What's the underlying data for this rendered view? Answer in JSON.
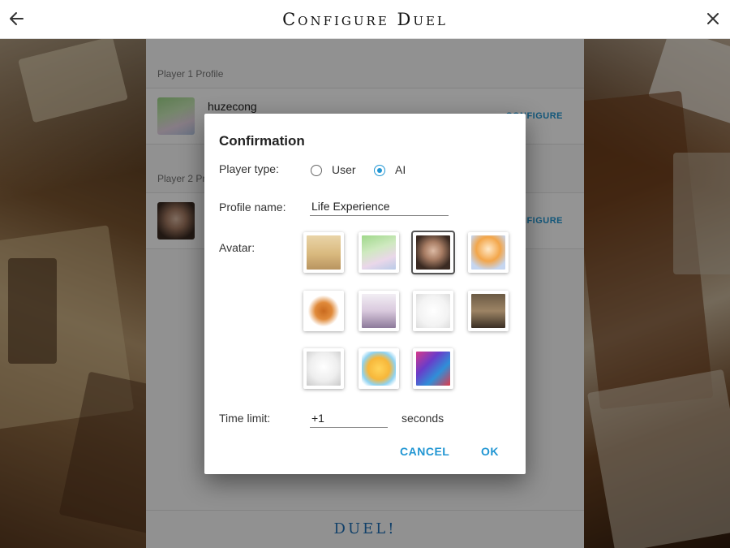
{
  "appbar": {
    "title": "Configure Duel",
    "back_icon": "arrow-left-icon",
    "close_icon": "close-icon"
  },
  "panel": {
    "player1_label": "Player 1 Profile",
    "player1_name": "huzecong",
    "player1_configure": "CONFIGURE",
    "player2_label": "Player 2 Profile",
    "player2_configure": "CONFIGURE",
    "duel_label": "DUEL!"
  },
  "dialog": {
    "title": "Confirmation",
    "player_type_label": "Player type:",
    "option_user": "User",
    "option_ai": "AI",
    "selected_type": "AI",
    "profile_name_label": "Profile name:",
    "profile_name_value": "Life Experience",
    "avatar_label": "Avatar:",
    "avatars": [
      {
        "name": "go-board-avatar"
      },
      {
        "name": "anime-green-hair-avatar"
      },
      {
        "name": "man-glasses-avatar",
        "selected": true
      },
      {
        "name": "anime-orange-hair-avatar"
      },
      {
        "name": "pixel-monkey-avatar"
      },
      {
        "name": "anime-white-hair-avatar"
      },
      {
        "name": "doodle-rabbit-avatar"
      },
      {
        "name": "you-say-it-meme-avatar"
      },
      {
        "name": "rage-face-avatar"
      },
      {
        "name": "crying-laughing-avatar"
      },
      {
        "name": "collage-avatar"
      }
    ],
    "time_limit_label": "Time limit:",
    "time_limit_value": "+1",
    "time_limit_unit": "seconds",
    "cancel_label": "CANCEL",
    "ok_label": "OK"
  },
  "colors": {
    "accent": "#2196d3",
    "duel": "#1e6fb5"
  }
}
